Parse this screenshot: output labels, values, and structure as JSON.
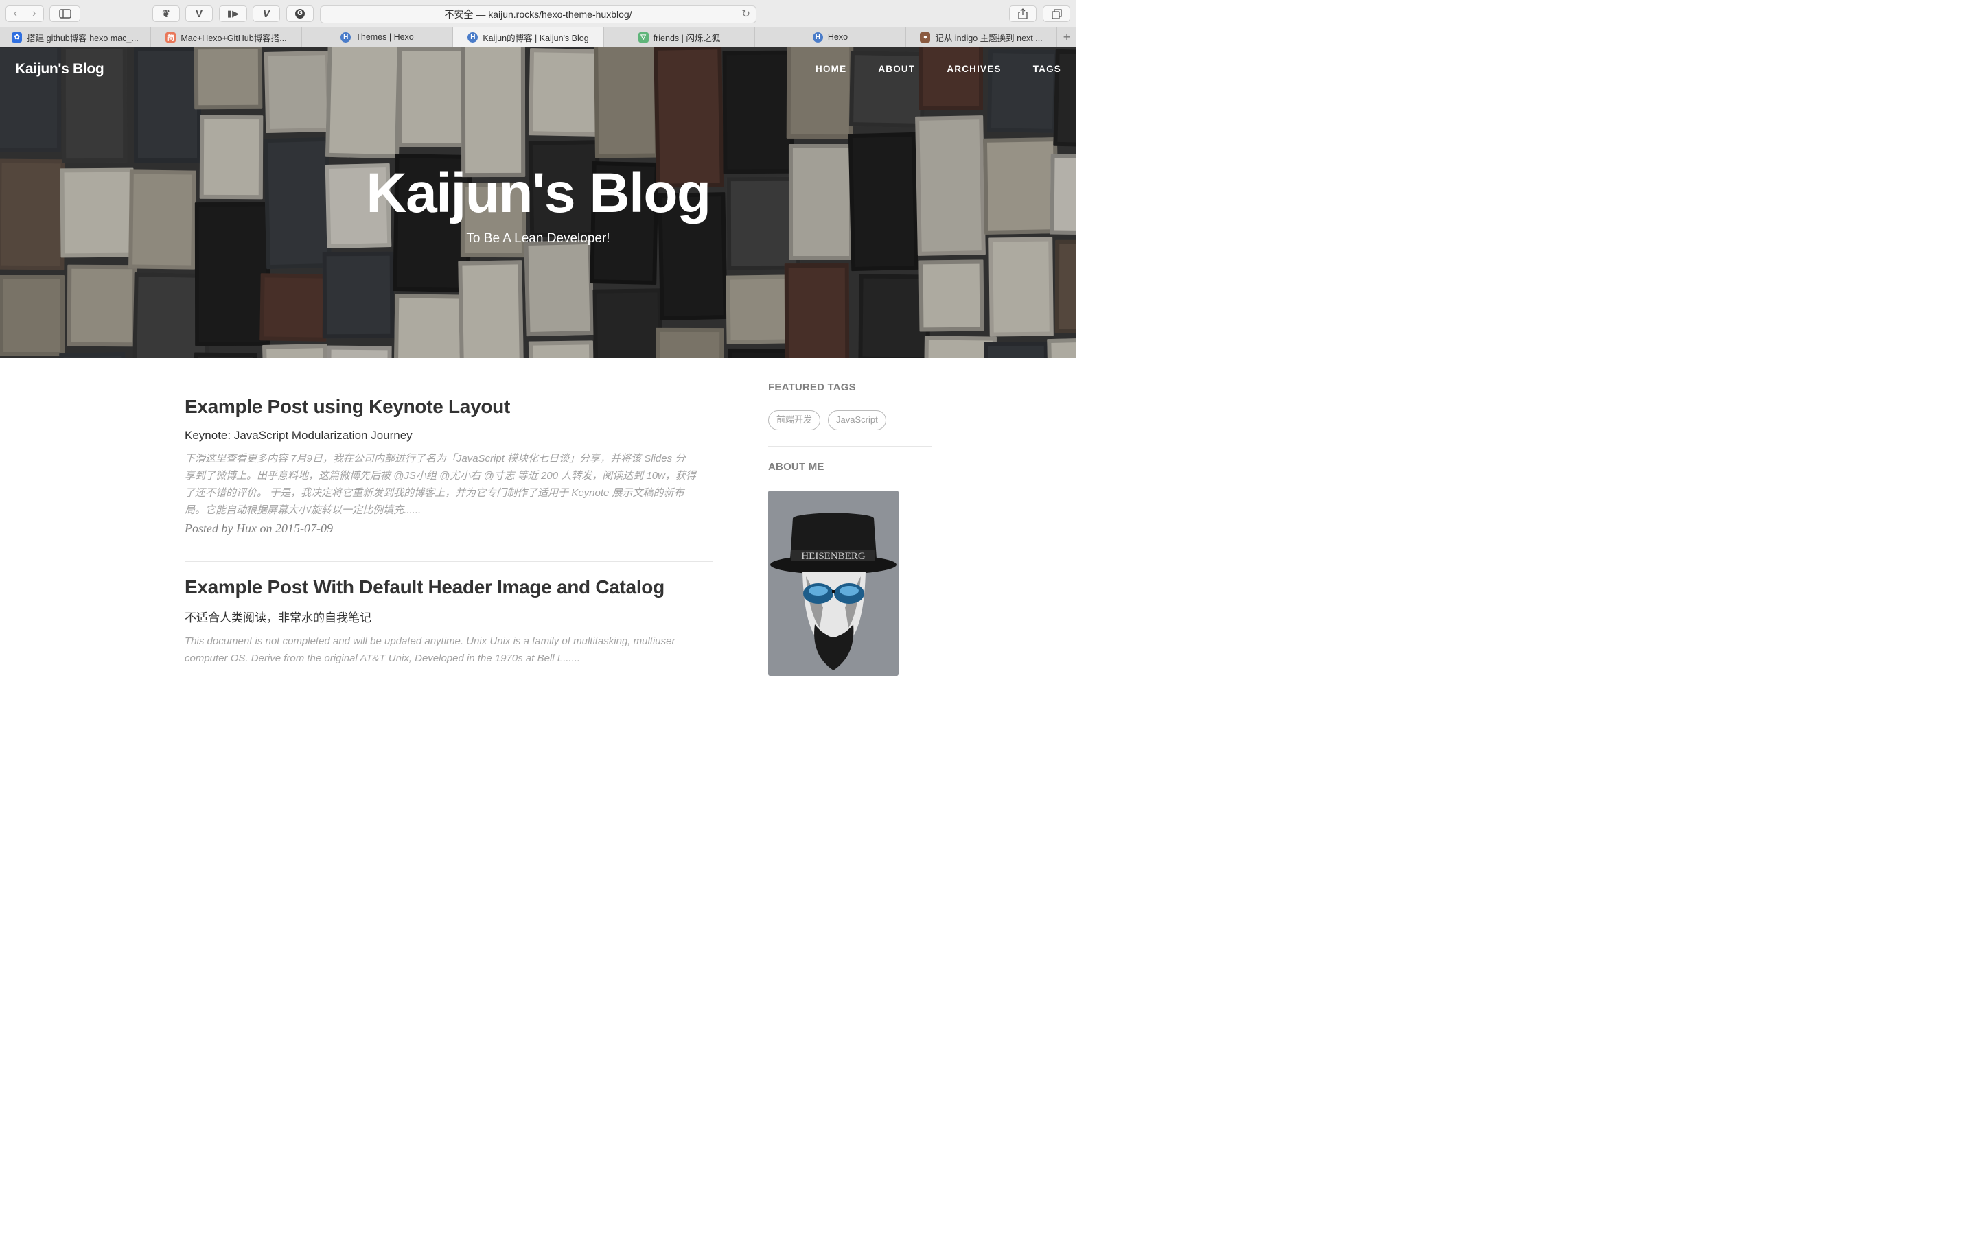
{
  "browser": {
    "address": "不安全 — kaijun.rocks/hexo-theme-huxblog/",
    "tabs": [
      {
        "label": "搭建 github博客 hexo mac_...",
        "icon": "baidu-paw-icon",
        "active": false
      },
      {
        "label": "Mac+Hexo+GitHub博客搭...",
        "icon": "jianshu-icon",
        "active": false
      },
      {
        "label": "Themes | Hexo",
        "icon": "hexo-icon",
        "active": false
      },
      {
        "label": "Kaijun的博客 | Kaijun's Blog",
        "icon": "hexo-icon",
        "active": true
      },
      {
        "label": "friends | 闪烁之狐",
        "icon": "fox-icon",
        "active": false
      },
      {
        "label": "Hexo",
        "icon": "hexo-icon",
        "active": false
      },
      {
        "label": "记从 indigo 主题换到 next ...",
        "icon": "avatar-icon",
        "active": false
      }
    ]
  },
  "site": {
    "brand": "Kaijun's Blog",
    "nav": [
      "HOME",
      "ABOUT",
      "ARCHIVES",
      "TAGS"
    ],
    "hero_title": "Kaijun's Blog",
    "hero_subtitle": "To Be A Lean Developer!"
  },
  "posts": [
    {
      "title": "Example Post using Keynote Layout",
      "subtitle": "Keynote: JavaScript Modularization Journey",
      "excerpt_lines": [
        "下滑这里查看更多内容 7月9日，我在公司内部进行了名为「JavaScript 模块化七日谈」分享，并将该 Slides 分",
        "享到了微博上。出乎意料地，这篇微博先后被 @JS小组 @尤小右 @寸志 等近 200 人转发，阅读达到 10w，获得",
        "了还不错的评价。 于是，我决定将它重新发到我的博客上，并为它专门制作了适用于 Keynote 展示文稿的新布",
        "局。它能自动根据屏幕大小/旋转以一定比例填充......"
      ],
      "meta": "Posted by Hux on 2015-07-09"
    },
    {
      "title": "Example Post With Default Header Image and Catalog",
      "subtitle": "不适合人类阅读，非常水的自我笔记",
      "excerpt_lines": [
        "This document is not completed and will be updated anytime. Unix Unix is a family of multitasking, multiuser",
        "computer OS. Derive from the original AT&T Unix, Developed in the 1970s at Bell L......"
      ],
      "meta": ""
    }
  ],
  "sidebar": {
    "featured_tags_heading": "FEATURED TAGS",
    "tags": [
      "前端开发",
      "JavaScript"
    ],
    "about_heading": "ABOUT ME",
    "avatar_text": "HEISENBERG"
  }
}
